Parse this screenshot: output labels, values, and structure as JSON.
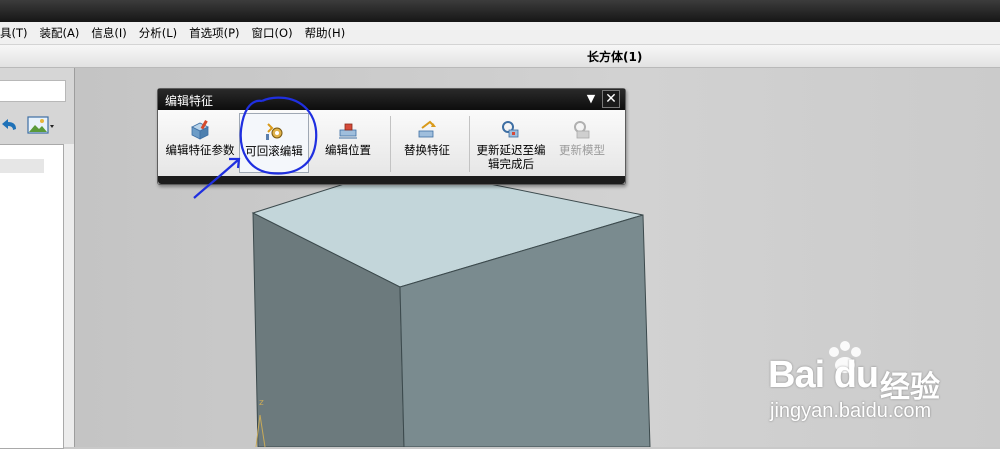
{
  "menu": {
    "items": [
      "具(T)",
      "装配(A)",
      "信息(I)",
      "分析(L)",
      "首选项(P)",
      "窗口(O)",
      "帮助(H)"
    ]
  },
  "document": {
    "title": "长方体(1)"
  },
  "dialog": {
    "title": "编辑特征",
    "menu_glyph": "▼",
    "close_glyph": "✕",
    "tools": [
      {
        "label": "编辑特征参数",
        "state": "enabled"
      },
      {
        "label": "可回滚编辑",
        "state": "highlighted"
      },
      {
        "label": "编辑位置",
        "state": "enabled"
      },
      {
        "label": "替换特征",
        "state": "enabled"
      },
      {
        "label_line1": "更新延迟至编",
        "label_line2": "辑完成后",
        "state": "enabled"
      },
      {
        "label": "更新模型",
        "state": "disabled"
      }
    ]
  },
  "viewport": {
    "axis_label": "z"
  },
  "watermark": {
    "logo": "Bai du",
    "brand": "经验",
    "url": "jingyan.baidu.com"
  },
  "colors": {
    "annotation": "#1f2fe0",
    "box_top": "#c3d6da",
    "box_left": "#6c7a7d",
    "box_right": "#7a8b8f"
  }
}
